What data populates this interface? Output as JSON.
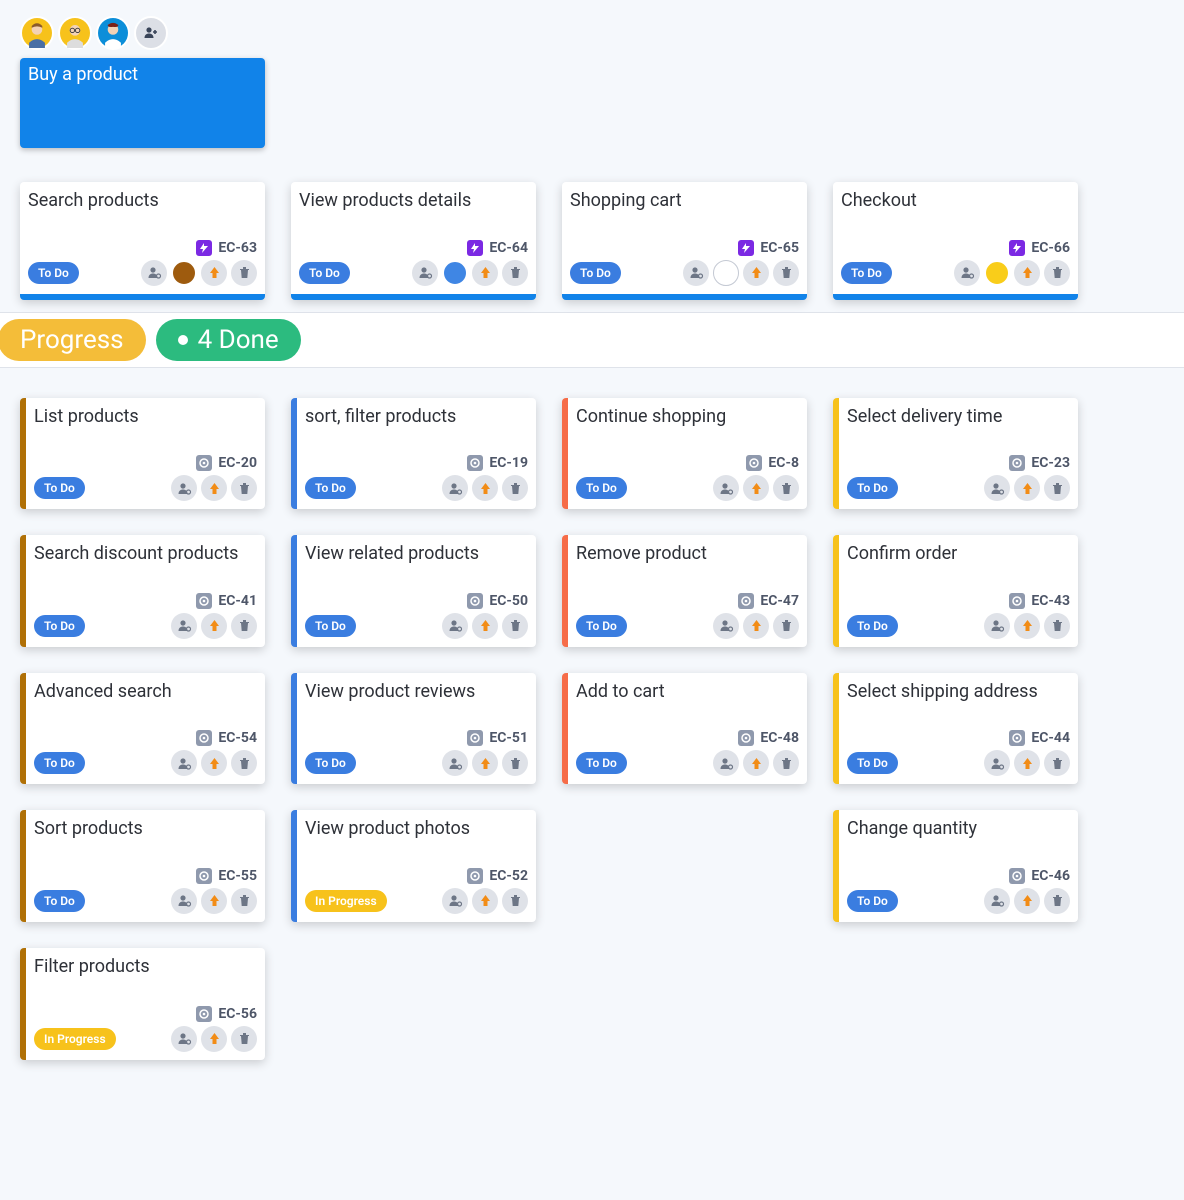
{
  "epic": {
    "title": "Buy a product"
  },
  "filter": {
    "progress_label": "Progress",
    "done_label": "4 Done"
  },
  "top_cards": [
    {
      "title": "Search products",
      "id": "EC-63",
      "status": "To Do",
      "assignee_color": "brown"
    },
    {
      "title": "View products details",
      "id": "EC-64",
      "status": "To Do",
      "assignee_color": "blue"
    },
    {
      "title": "Shopping cart",
      "id": "EC-65",
      "status": "To Do",
      "assignee_color": "coral"
    },
    {
      "title": "Checkout",
      "id": "EC-66",
      "status": "To Do",
      "assignee_color": "yellow"
    }
  ],
  "columns": [
    {
      "edge": "brown",
      "cards": [
        {
          "title": "List products",
          "id": "EC-20",
          "status": "To Do"
        },
        {
          "title": "Search discount products",
          "id": "EC-41",
          "status": "To Do"
        },
        {
          "title": "Advanced search",
          "id": "EC-54",
          "status": "To Do"
        },
        {
          "title": "Sort products",
          "id": "EC-55",
          "status": "To Do"
        },
        {
          "title": "Filter products",
          "id": "EC-56",
          "status": "In Progress"
        }
      ]
    },
    {
      "edge": "blue",
      "cards": [
        {
          "title": "sort, filter products",
          "id": "EC-19",
          "status": "To Do"
        },
        {
          "title": "View related products",
          "id": "EC-50",
          "status": "To Do"
        },
        {
          "title": "View product reviews",
          "id": "EC-51",
          "status": "To Do"
        },
        {
          "title": "View product photos",
          "id": "EC-52",
          "status": "In Progress"
        }
      ]
    },
    {
      "edge": "orange",
      "cards": [
        {
          "title": "Continue shopping",
          "id": "EC-8",
          "status": "To Do"
        },
        {
          "title": "Remove product",
          "id": "EC-47",
          "status": "To Do"
        },
        {
          "title": "Add to cart",
          "id": "EC-48",
          "status": "To Do"
        }
      ]
    },
    {
      "edge": "yellow",
      "cards": [
        {
          "title": "Select delivery time",
          "id": "EC-23",
          "status": "To Do"
        },
        {
          "title": "Confirm order",
          "id": "EC-43",
          "status": "To Do"
        },
        {
          "title": "Select shipping address",
          "id": "EC-44",
          "status": "To Do"
        },
        {
          "title": "Change quantity",
          "id": "EC-46",
          "status": "To Do"
        }
      ]
    }
  ]
}
